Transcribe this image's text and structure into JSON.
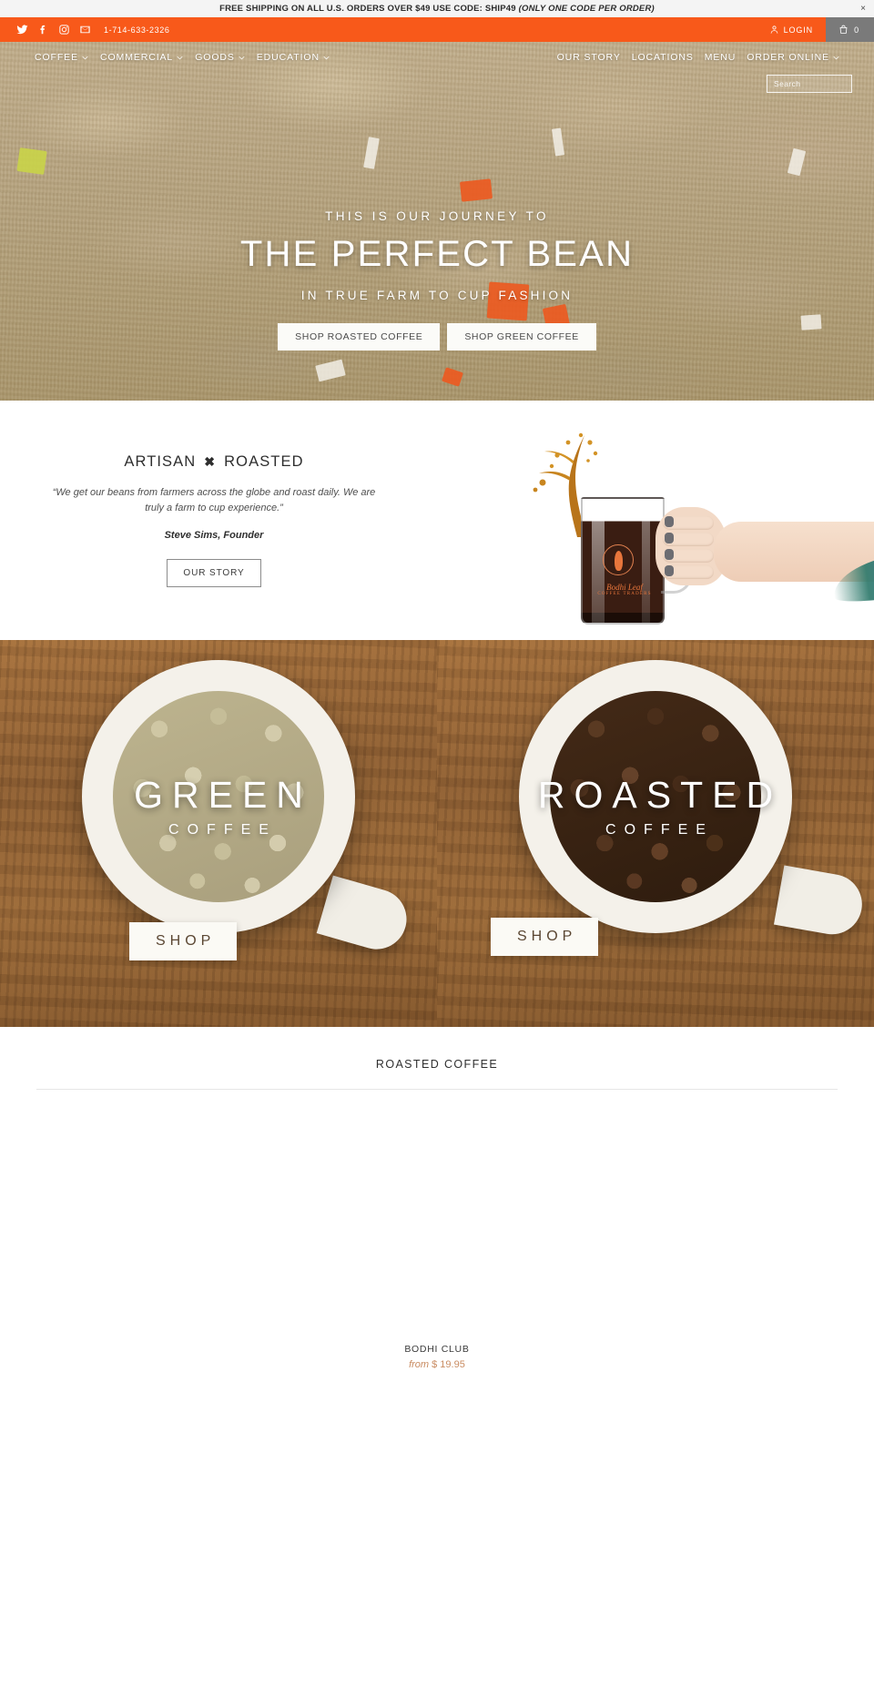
{
  "announcement": {
    "text": "FREE SHIPPING ON ALL U.S. ORDERS OVER $49 USE CODE: SHIP49 ",
    "italic_text": "(ONLY ONE CODE PER ORDER)",
    "close_label": "×"
  },
  "utility": {
    "social": [
      {
        "name": "twitter-icon",
        "label": "Twitter"
      },
      {
        "name": "facebook-icon",
        "label": "Facebook"
      },
      {
        "name": "instagram-icon",
        "label": "Instagram"
      },
      {
        "name": "email-icon",
        "label": "Email"
      }
    ],
    "phone": "1-714-633-2326",
    "login_label": "LOGIN",
    "cart_count": "0",
    "orange": "#f8591a",
    "cart_bg": "#7a7a7a"
  },
  "nav": {
    "left": [
      {
        "label": "COFFEE",
        "has_dropdown": true
      },
      {
        "label": "COMMERCIAL",
        "has_dropdown": true
      },
      {
        "label": "GOODS",
        "has_dropdown": true
      },
      {
        "label": "EDUCATION",
        "has_dropdown": true
      }
    ],
    "right": [
      {
        "label": "OUR STORY",
        "has_dropdown": false
      },
      {
        "label": "LOCATIONS",
        "has_dropdown": false
      },
      {
        "label": "MENU",
        "has_dropdown": false
      },
      {
        "label": "ORDER ONLINE",
        "has_dropdown": true
      }
    ]
  },
  "search": {
    "placeholder": "Search",
    "value": ""
  },
  "hero": {
    "kicker": "THIS IS OUR JOURNEY TO",
    "title": "THE PERFECT BEAN",
    "subtitle": "IN TRUE FARM TO CUP FASHION",
    "button_primary": "SHOP ROASTED COFFEE",
    "button_secondary": "SHOP GREEN COFFEE"
  },
  "artisan": {
    "heading_left": "ARTISAN",
    "heading_mark": "✖",
    "heading_right": "ROASTED",
    "quote": "“We get our beans from farmers across the globe and roast daily. We are truly a farm to cup experience.”",
    "signature": "Steve Sims, Founder",
    "button": "OUR STORY",
    "mug_brand": "Bodhi Leaf",
    "mug_brand_sub": "COFFEE TRADERS"
  },
  "split": [
    {
      "title": "GREEN",
      "subtitle": "COFFEE",
      "shop_label": "SHOP"
    },
    {
      "title": "ROASTED",
      "subtitle": "COFFEE",
      "shop_label": "SHOP"
    }
  ],
  "products": {
    "heading": "ROASTED COFFEE",
    "items": [
      {
        "name": "",
        "price_from": "",
        "price": ""
      },
      {
        "name": "BODHI CLUB",
        "price_from": "from",
        "price": "$ 19.95"
      },
      {
        "name": "",
        "price_from": "",
        "price": ""
      }
    ]
  },
  "colors": {
    "accent_orange": "#f8591a",
    "price_tan": "#c98c62",
    "text_dark": "#2e2e2e"
  }
}
